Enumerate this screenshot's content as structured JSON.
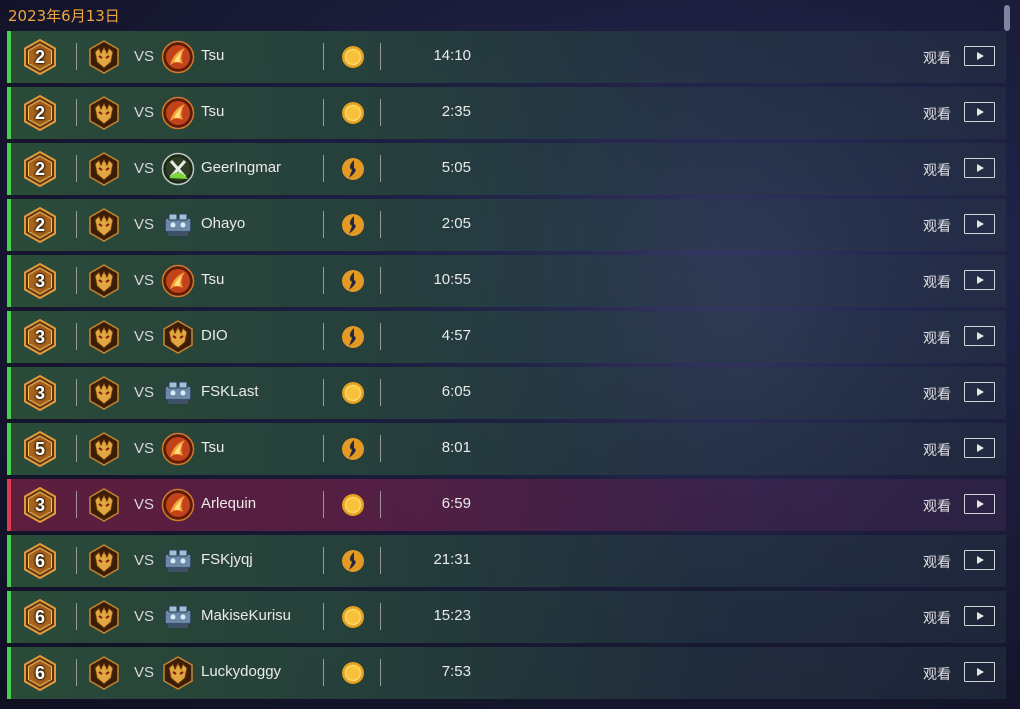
{
  "date_header": "2023年6月13日",
  "watch_label": "观看",
  "vs_label": "VS",
  "colors": {
    "win": "#46d04a",
    "loss": "#e03a4a",
    "date": "#f0a640"
  },
  "matches": [
    {
      "rank": "2",
      "opponent": "Tsu",
      "opponent_icon": "fire-mage-icon",
      "mode_icon": "coin-icon",
      "duration": "14:10",
      "result": "win"
    },
    {
      "rank": "2",
      "opponent": "Tsu",
      "opponent_icon": "fire-mage-icon",
      "mode_icon": "coin-icon",
      "duration": "2:35",
      "result": "win"
    },
    {
      "rank": "2",
      "opponent": "GeerIngmar",
      "opponent_icon": "green-claw-icon",
      "mode_icon": "lightning-icon",
      "duration": "5:05",
      "result": "win"
    },
    {
      "rank": "2",
      "opponent": "Ohayo",
      "opponent_icon": "mech-icon",
      "mode_icon": "lightning-icon",
      "duration": "2:05",
      "result": "win"
    },
    {
      "rank": "3",
      "opponent": "Tsu",
      "opponent_icon": "fire-mage-icon",
      "mode_icon": "lightning-icon",
      "duration": "10:55",
      "result": "win"
    },
    {
      "rank": "3",
      "opponent": "DIO",
      "opponent_icon": "demon-icon",
      "mode_icon": "lightning-icon",
      "duration": "4:57",
      "result": "win"
    },
    {
      "rank": "3",
      "opponent": "FSKLast",
      "opponent_icon": "mech-icon",
      "mode_icon": "coin-icon",
      "duration": "6:05",
      "result": "win"
    },
    {
      "rank": "5",
      "opponent": "Tsu",
      "opponent_icon": "fire-mage-icon",
      "mode_icon": "lightning-icon",
      "duration": "8:01",
      "result": "win"
    },
    {
      "rank": "3",
      "opponent": "Arlequin",
      "opponent_icon": "fire-mage-icon",
      "mode_icon": "coin-icon",
      "duration": "6:59",
      "result": "loss"
    },
    {
      "rank": "6",
      "opponent": "FSKjyqj",
      "opponent_icon": "mech-icon",
      "mode_icon": "lightning-icon",
      "duration": "21:31",
      "result": "win"
    },
    {
      "rank": "6",
      "opponent": "MakiseKurisu",
      "opponent_icon": "mech-icon",
      "mode_icon": "coin-icon",
      "duration": "15:23",
      "result": "win"
    },
    {
      "rank": "6",
      "opponent": "Luckydoggy",
      "opponent_icon": "demon-icon",
      "mode_icon": "coin-icon",
      "duration": "7:53",
      "result": "win"
    }
  ]
}
